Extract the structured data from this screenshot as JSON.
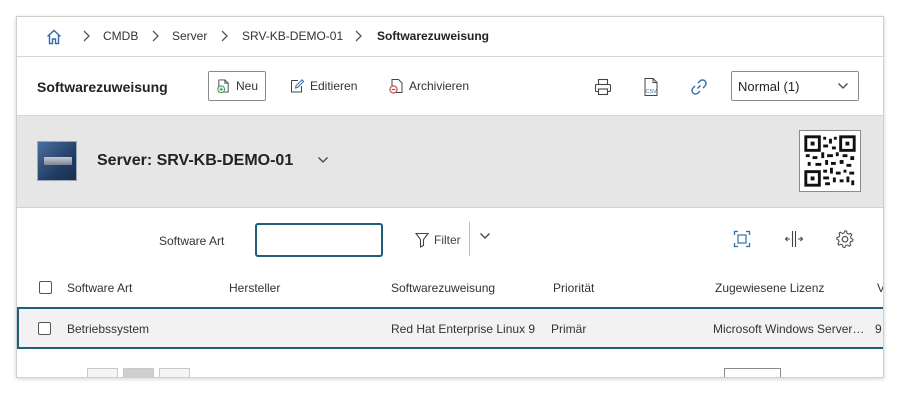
{
  "breadcrumb": {
    "items": [
      "CMDB",
      "Server",
      "SRV-KB-DEMO-01"
    ],
    "current": "Softwarezuweisung"
  },
  "toolbar": {
    "title": "Softwarezuweisung",
    "new_label": "Neu",
    "edit_label": "Editieren",
    "archive_label": "Archivieren",
    "view_select": "Normal (1)"
  },
  "object": {
    "title": "Server: SRV-KB-DEMO-01"
  },
  "filter": {
    "label": "Software Art",
    "input_value": "",
    "filter_label": "Filter"
  },
  "table": {
    "columns": [
      "Software Art",
      "Hersteller",
      "Softwarezuweisung",
      "Priorität",
      "Zugewiesene Lizenz",
      "V"
    ],
    "rows": [
      [
        "Betriebssystem",
        "",
        "Red Hat Enterprise Linux 9",
        "Primär",
        "Microsoft Windows Server…",
        "9"
      ]
    ]
  },
  "colors": {
    "accent": "#1f5f7a",
    "header_bg": "#e6e6e6",
    "icon_blue": "#2f6ea8",
    "icon_green": "#3a9a4a",
    "icon_red": "#c84040"
  }
}
